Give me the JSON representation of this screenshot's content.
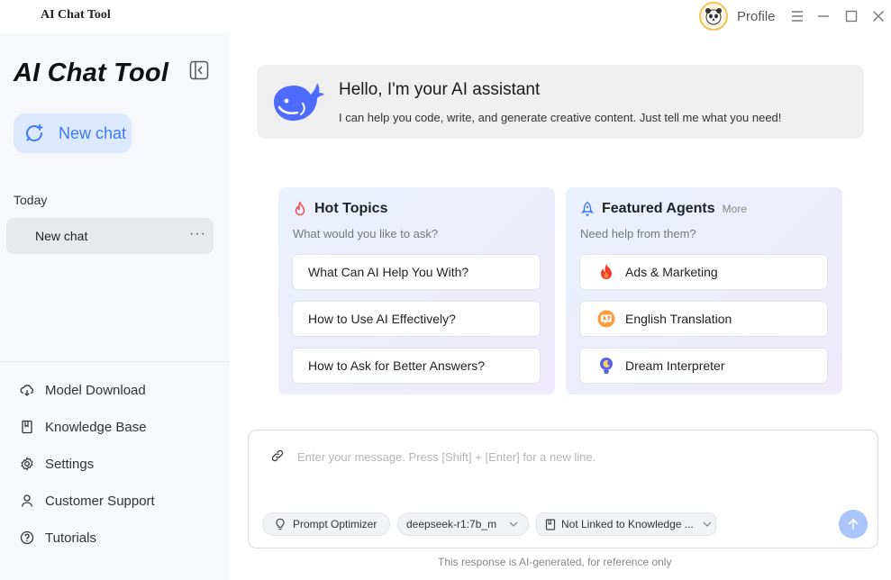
{
  "window": {
    "title": "AI Chat Tool",
    "profile_label": "Profile"
  },
  "sidebar": {
    "brand": "AI Chat Tool",
    "new_chat_label": "New chat",
    "section_today": "Today",
    "chats": [
      {
        "label": "New chat",
        "more": "···"
      }
    ],
    "nav": [
      {
        "label": "Model Download",
        "icon": "cloud-download-icon"
      },
      {
        "label": "Knowledge Base",
        "icon": "book-icon"
      },
      {
        "label": "Settings",
        "icon": "gear-icon"
      },
      {
        "label": "Customer Support",
        "icon": "user-icon"
      },
      {
        "label": "Tutorials",
        "icon": "help-circle-icon"
      }
    ]
  },
  "hero": {
    "title": "Hello, I'm your AI assistant",
    "subtitle": "I can help you code, write, and generate creative content. Just tell me what you need!"
  },
  "hot_topics": {
    "title": "Hot Topics",
    "subtitle": "What would you like to ask?",
    "items": [
      "What Can AI Help You With?",
      "How to Use AI Effectively?",
      "How to Ask for Better Answers?"
    ]
  },
  "featured_agents": {
    "title": "Featured Agents",
    "more": "More",
    "subtitle": "Need help from them?",
    "items": [
      {
        "label": "Ads & Marketing",
        "icon": "flame-icon"
      },
      {
        "label": "English Translation",
        "icon": "translation-icon"
      },
      {
        "label": "Dream Interpreter",
        "icon": "dream-icon"
      }
    ]
  },
  "composer": {
    "placeholder": "Enter your message. Press [Shift] + [Enter] for a new line.",
    "prompt_optimizer": "Prompt Optimizer",
    "model": "deepseek-r1:7b_m",
    "knowledge": "Not Linked to Knowledge ...",
    "disclaimer": "This response is AI-generated, for reference only"
  },
  "colors": {
    "accent": "#3e7bf7",
    "new_chat_bg": "#dce8fe",
    "send_button": "#a9c5fb"
  }
}
